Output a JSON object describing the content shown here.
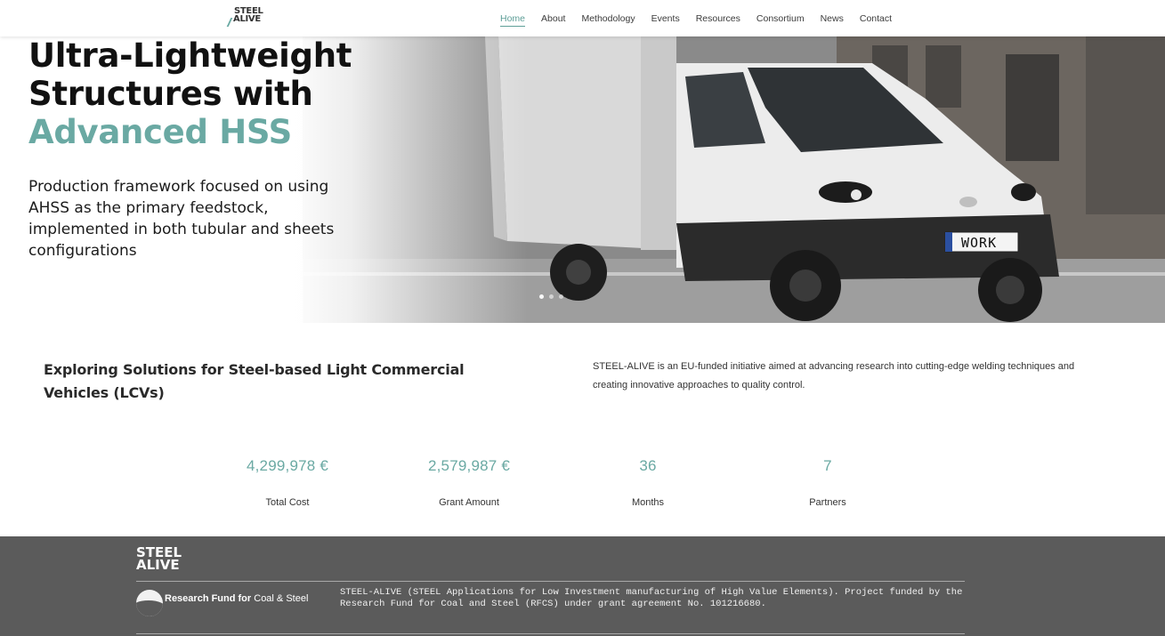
{
  "brand": {
    "logo_line1": "STEEL",
    "logo_line2": "ALIVE"
  },
  "nav": {
    "items": [
      {
        "label": "Home",
        "active": true
      },
      {
        "label": "About",
        "active": false
      },
      {
        "label": "Methodology",
        "active": false
      },
      {
        "label": "Events",
        "active": false
      },
      {
        "label": "Resources",
        "active": false
      },
      {
        "label": "Consortium",
        "active": false
      },
      {
        "label": "News",
        "active": false
      },
      {
        "label": "Contact",
        "active": false
      }
    ]
  },
  "hero": {
    "title_line1": "Ultra-Lightweight",
    "title_line2": "Structures with",
    "title_accent": "Advanced HSS",
    "subtitle": "Production framework focused on using AHSS as the primary feedstock, implemented in both tubular and sheets configurations",
    "plate_text": "WORK",
    "slide_count": 3,
    "active_slide": 1
  },
  "intro": {
    "heading": "Exploring Solutions for Steel-based Light Commercial Vehicles (LCVs)",
    "text": "STEEL-ALIVE is an EU-funded initiative aimed at advancing research into cutting-edge welding techniques and creating innovative approaches to quality control."
  },
  "stats": [
    {
      "value": "4,299,978 €",
      "label": "Total Cost"
    },
    {
      "value": "2,579,987 €",
      "label": "Grant Amount"
    },
    {
      "value": "36",
      "label": "Months"
    },
    {
      "value": "7",
      "label": "Partners"
    }
  ],
  "footer": {
    "logo_line1": "STEEL",
    "logo_line2": "ALIVE",
    "fund_name_bold": "Research Fund for",
    "fund_name_light": "Coal & Steel",
    "description": "STEEL-ALIVE (STEEL Applications for Low Investment manufacturing of High Value Elements). Project funded by the Research Fund for Coal and Steel (RFCS) under grant agreement No. 101216680."
  },
  "colors": {
    "accent": "#6aa9a3",
    "footer_bg": "#5b5b5b",
    "text": "#222222"
  }
}
